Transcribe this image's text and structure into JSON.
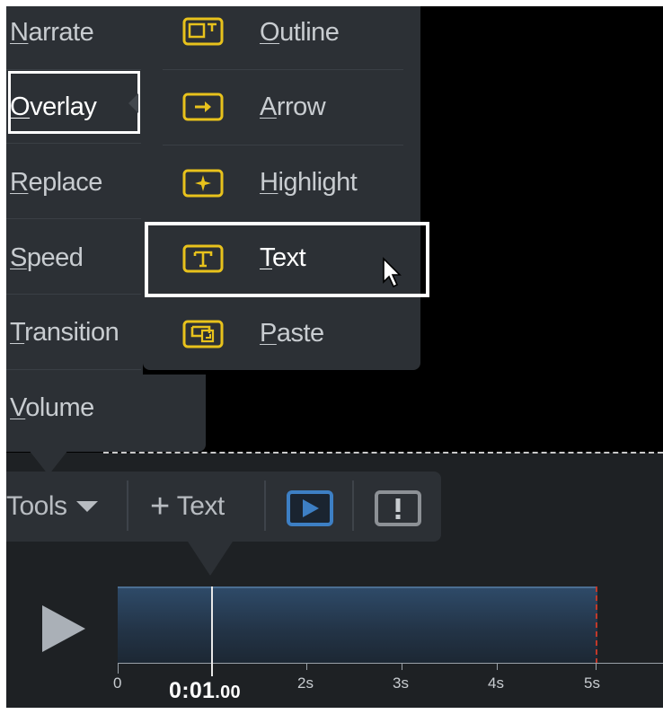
{
  "edit_menu": {
    "items": [
      {
        "label_u": "N",
        "label_rest": "arrate"
      },
      {
        "label_u": "O",
        "label_rest": "verlay"
      },
      {
        "label_u": "R",
        "label_rest": "eplace"
      },
      {
        "label_u": "S",
        "label_rest": "peed"
      },
      {
        "label_u": "T",
        "label_rest": "ransition"
      },
      {
        "label_u": "V",
        "label_rest": "olume"
      }
    ]
  },
  "overlay_submenu": {
    "items": [
      {
        "label_u": "O",
        "label_rest": "utline",
        "icon": "outline-icon"
      },
      {
        "label_u": "A",
        "label_rest": "rrow",
        "icon": "arrow-box-icon"
      },
      {
        "label_u": "H",
        "label_rest": "ighlight",
        "icon": "highlight-icon"
      },
      {
        "label_u": "T",
        "label_rest": "ext",
        "icon": "text-box-icon"
      },
      {
        "label_u": "P",
        "label_rest": "aste",
        "icon": "paste-icon"
      }
    ],
    "icon_color": "#e8c21c"
  },
  "toolbar": {
    "tools_label": "Tools",
    "add_text_plus": "+",
    "add_text_label": "Text",
    "preview_icon": "play-box-icon",
    "preview_color": "#3d7fc4",
    "alert_icon": "exclamation-box-icon"
  },
  "timeline": {
    "current_time_main": "0:01",
    "current_time_frac": ".00",
    "ticks": [
      "0",
      "2s",
      "3s",
      "4s",
      "5s"
    ],
    "clip_color": "#2e4a68",
    "end_marker_color": "#c0392b"
  }
}
